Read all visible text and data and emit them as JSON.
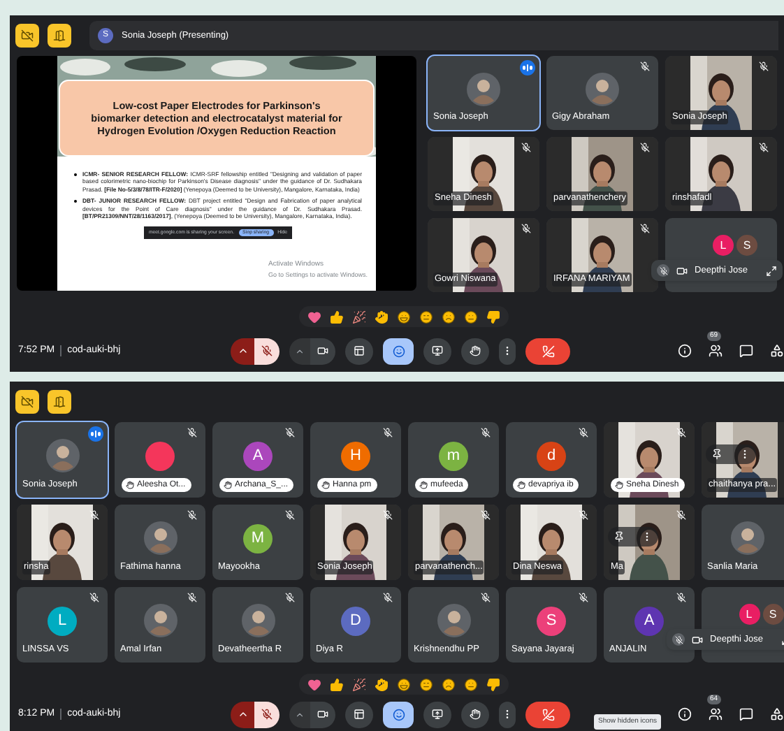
{
  "screens": [
    {
      "header": {
        "presenter_initial": "S",
        "presenter": "Sonia Joseph (Presenting)"
      },
      "slide": {
        "title": "Low-cost Paper Electrodes for Parkinson's biomarker detection and electrocatalyst material for Hydrogen Evolution /Oxygen Reduction Reaction",
        "bullets": [
          "**ICMR- SENIOR RESEARCH FELLOW:** ICMR-SRF fellowship entitled \"Designing and validation of paper based colorimetric nano-biochip for Parkinson's Disease diagnosis\" under the guidance of Dr. Sudhakara Prasad. **[File No-5/3/8/78/ITR-F/2020]** (Yenepoya (Deemed to be University), Mangalore, Karnataka, India)",
          "**DBT- JUNIOR RESEARCH FELLOW:** DBT project entitled \"Design and Fabrication of paper analytical devices for the Point of Care diagnosis\" under the guidance of Dr. Sudhakara Prasad. **[BT/PR21309/NNT/28/1163/2017]**, (Yenepoya (Deemed to be University), Mangalore, Karnataka, India)."
        ],
        "share_notice": "meet.google.com is sharing your screen.",
        "stop_button": "Stop sharing",
        "hide_button": "Hide",
        "watermark_title": "Activate Windows",
        "watermark_text": "Go to Settings to activate Windows."
      },
      "tiles": [
        {
          "name": "Sonia Joseph",
          "selected": true,
          "speaking": true,
          "muted": false
        },
        {
          "name": "Gigy Abraham",
          "selected": false,
          "speaking": false,
          "muted": true
        },
        {
          "name": "Sonia Joseph",
          "kind": "video",
          "selected": false,
          "speaking": false,
          "muted": true
        },
        {
          "name": "Sneha Dinesh",
          "kind": "video",
          "selected": false,
          "speaking": false,
          "muted": true
        },
        {
          "name": "parvanathenchery",
          "kind": "video",
          "selected": false,
          "speaking": false,
          "muted": true
        },
        {
          "name": "rinshafadl",
          "kind": "video",
          "selected": false,
          "speaking": false,
          "muted": true
        },
        {
          "name": "Gowri Niswana",
          "kind": "video",
          "selected": false,
          "speaking": false,
          "muted": true
        },
        {
          "name": "IRFANA MARIYAM",
          "kind": "video",
          "selected": false,
          "speaking": false,
          "muted": true
        },
        {
          "kind": "pair",
          "selected": false,
          "speaking": false,
          "muted": false,
          "letters": [
            {
              "letter": "L",
              "color": "#e91e63"
            },
            {
              "letter": "S",
              "color": "#6d4c41"
            }
          ],
          "overlay_name": "Deepthi Jose"
        }
      ],
      "toolbar": {
        "time": "7:52 PM",
        "code": "cod-auki-bhj",
        "participants": "69"
      }
    },
    {
      "tiles": [
        {
          "name": "Sonia Joseph",
          "selected": true,
          "speaking": true,
          "muted": false,
          "hand_raised": false
        },
        {
          "name": "Aleesha Ot...",
          "kind": "letter",
          "color": "#f4365b",
          "selected": false,
          "speaking": false,
          "muted": true,
          "hand_raised": true
        },
        {
          "name": "Archana_S_...",
          "kind": "letter",
          "letter": "A",
          "color": "#ab47bc",
          "selected": false,
          "speaking": false,
          "muted": true,
          "hand_raised": true
        },
        {
          "name": "Hanna pm",
          "kind": "letter",
          "letter": "H",
          "color": "#ef6c00",
          "selected": false,
          "speaking": false,
          "muted": true,
          "hand_raised": true
        },
        {
          "name": "mufeeda",
          "kind": "letter",
          "letter": "m",
          "color": "#7cb342",
          "selected": false,
          "speaking": false,
          "muted": true,
          "hand_raised": true
        },
        {
          "name": "devapriya ib",
          "kind": "letter",
          "letter": "d",
          "color": "#d84315",
          "selected": false,
          "speaking": false,
          "muted": true,
          "hand_raised": true
        },
        {
          "name": "Sneha Dinesh",
          "kind": "video",
          "selected": false,
          "speaking": false,
          "muted": true,
          "hand_raised": true
        },
        {
          "name": "chaithanya pra...",
          "kind": "video",
          "selected": false,
          "speaking": false,
          "muted": false,
          "hand_raised": false,
          "pin_controls": true
        },
        {
          "name": "rinsha",
          "kind": "video",
          "selected": false,
          "speaking": false,
          "muted": true,
          "hand_raised": false
        },
        {
          "name": "Fathima hanna",
          "selected": false,
          "speaking": false,
          "muted": true,
          "hand_raised": false
        },
        {
          "name": "Mayookha",
          "kind": "letter",
          "letter": "M",
          "color": "#7cb342",
          "selected": false,
          "speaking": false,
          "muted": true,
          "hand_raised": false
        },
        {
          "name": "Sonia Joseph",
          "kind": "video",
          "selected": false,
          "speaking": false,
          "muted": true,
          "hand_raised": false
        },
        {
          "name": "parvanathench...",
          "kind": "video",
          "selected": false,
          "speaking": false,
          "muted": true,
          "hand_raised": false
        },
        {
          "name": "Dina Neswa",
          "kind": "video",
          "selected": false,
          "speaking": false,
          "muted": true,
          "hand_raised": false
        },
        {
          "name": "Ma",
          "kind": "video",
          "selected": false,
          "speaking": false,
          "muted": true,
          "hand_raised": false,
          "pin_controls": true
        },
        {
          "name": "Sanlia Maria",
          "selected": false,
          "speaking": false,
          "muted": false,
          "hand_raised": false
        },
        {
          "name": "LINSSA VS",
          "kind": "letter",
          "letter": "L",
          "color": "#00acc1",
          "selected": false,
          "speaking": false,
          "muted": true,
          "hand_raised": false
        },
        {
          "name": "Amal Irfan",
          "selected": false,
          "speaking": false,
          "muted": true,
          "hand_raised": false
        },
        {
          "name": "Devatheertha R",
          "selected": false,
          "speaking": false,
          "muted": true,
          "hand_raised": false
        },
        {
          "name": "Diya R",
          "kind": "letter",
          "letter": "D",
          "color": "#5c6bc0",
          "selected": false,
          "speaking": false,
          "muted": true,
          "hand_raised": false
        },
        {
          "name": "Krishnendhu PP",
          "selected": false,
          "speaking": false,
          "muted": true,
          "hand_raised": false
        },
        {
          "name": "Sayana Jayaraj",
          "kind": "letter",
          "letter": "S",
          "color": "#ec407a",
          "selected": false,
          "speaking": false,
          "muted": true,
          "hand_raised": false
        },
        {
          "name": "ANJALIN",
          "kind": "letter",
          "letter": "A",
          "color": "#5e35b1",
          "selected": false,
          "speaking": false,
          "muted": true,
          "hand_raised": false
        },
        {
          "kind": "pair",
          "selected": false,
          "speaking": false,
          "muted": false,
          "hand_raised": false,
          "letters": [
            {
              "letter": "L",
              "color": "#e91e63"
            },
            {
              "letter": "S",
              "color": "#6d4c41"
            }
          ],
          "overlay_name": "Deepthi Jose"
        }
      ],
      "toolbar": {
        "time": "8:12 PM",
        "code": "cod-auki-bhj",
        "participants": "64",
        "tooltip": "Show hidden icons"
      }
    }
  ]
}
